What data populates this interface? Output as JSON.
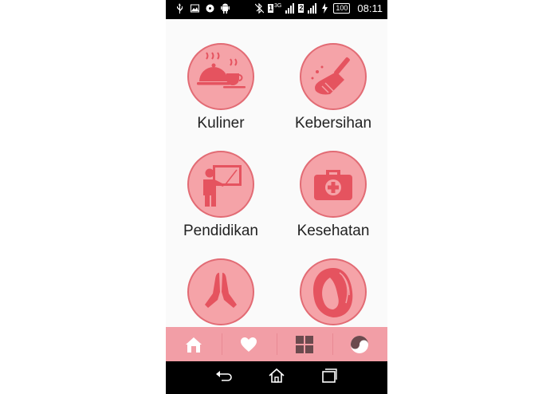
{
  "status_bar": {
    "network_badge": "3G",
    "sim1": "1",
    "sim2": "2",
    "battery": "100",
    "time": "08:11"
  },
  "categories": [
    {
      "label": "Kuliner",
      "icon": "food-cloche-icon"
    },
    {
      "label": "Kebersihan",
      "icon": "broom-icon"
    },
    {
      "label": "Pendidikan",
      "icon": "teacher-board-icon"
    },
    {
      "label": "Kesehatan",
      "icon": "first-aid-kit-icon"
    },
    {
      "label": "",
      "icon": "praying-hands-icon"
    },
    {
      "label": "",
      "icon": "woman-face-icon"
    }
  ],
  "tab_bar": {
    "tabs": [
      {
        "icon": "home-icon",
        "active": true
      },
      {
        "icon": "heart-icon",
        "active": false
      },
      {
        "icon": "grid-icon",
        "active": false
      },
      {
        "icon": "yin-yang-icon",
        "active": false
      }
    ]
  },
  "colors": {
    "accent": "#f29ea6",
    "circle_fill": "#f5a3a8",
    "circle_border": "#e26b74",
    "icon_fill": "#e5535f"
  }
}
